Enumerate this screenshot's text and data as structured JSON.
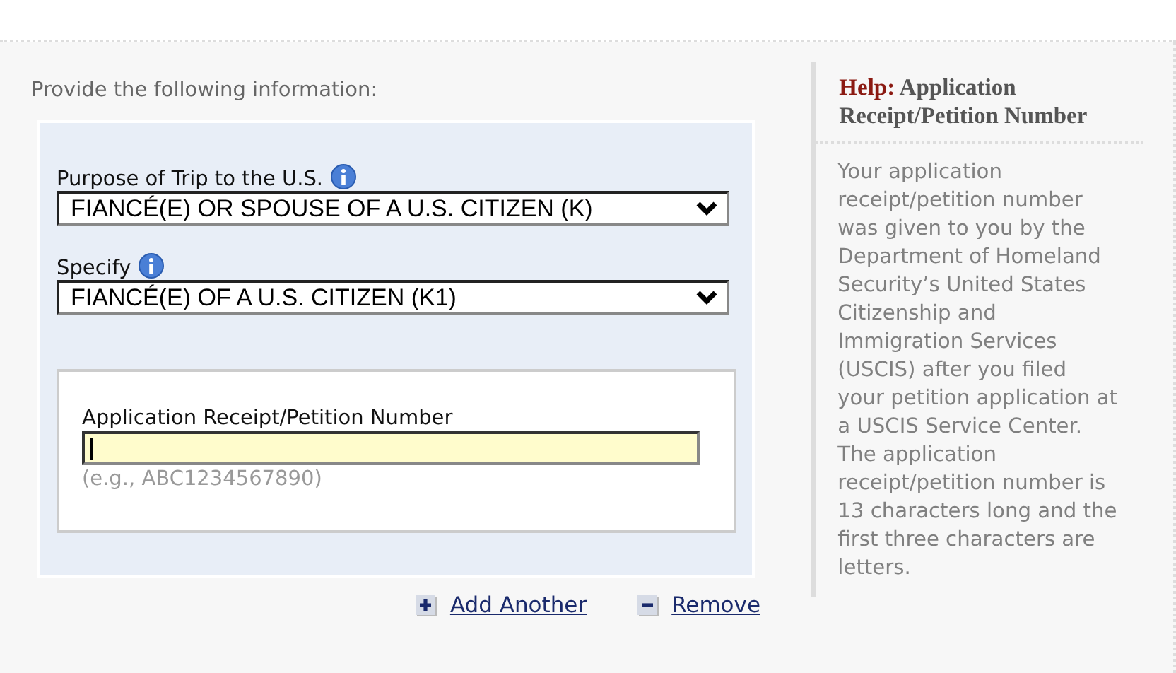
{
  "instruction": "Provide the following information:",
  "fields": [
    {
      "kind": "select",
      "label": "Purpose of Trip to the U.S.",
      "value": "FIANCÉ(E) OR SPOUSE OF A U.S. CITIZEN (K)"
    },
    {
      "kind": "select",
      "label": "Specify",
      "value": "FIANCÉ(E) OF A U.S. CITIZEN (K1)"
    }
  ],
  "petition": {
    "label": "Application Receipt/Petition Number",
    "focused": true,
    "hint": "(e.g., ABC1234567890)"
  },
  "actions": [
    {
      "kind": "add",
      "label": "Add Another"
    },
    {
      "kind": "remove",
      "label": "Remove"
    }
  ],
  "help": {
    "prefix": "Help:",
    "title": "Application Receipt/Petition Number",
    "body": "Your application receipt/petition number was given to you by the Department of Homeland Security’s United States Citizenship and Immigration Services (USCIS) after you filed your petition application at a USCIS Service Center. The application receipt/petition number is 13 characters long and the first three characters are letters."
  }
}
